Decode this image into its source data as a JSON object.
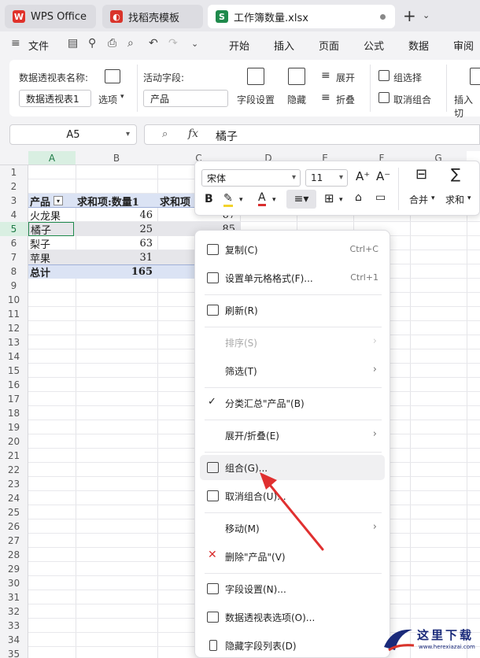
{
  "tabs": [
    {
      "label": "WPS Office",
      "icon_color": "#e0322b"
    },
    {
      "label": "找稻壳模板",
      "icon_color": "#d9342b"
    },
    {
      "label": "工作簿数量.xlsx",
      "icon_color": "#1f8a4c",
      "icon_letter": "S"
    }
  ],
  "menubar": {
    "file": "文件",
    "items": [
      "开始",
      "插入",
      "页面",
      "公式",
      "数据",
      "审阅"
    ]
  },
  "ribbon": {
    "pivot_name_label": "数据透视表名称:",
    "pivot_name_value": "数据透视表1",
    "options_label": "选项",
    "active_field_label": "活动字段:",
    "active_field_value": "产品",
    "field_settings": "字段设置",
    "hide": "隐藏",
    "expand": "展开",
    "collapse": "折叠",
    "group_selection": "组选择",
    "ungroup": "取消组合",
    "insert_slicer": "插入切"
  },
  "formula_bar": {
    "cell_ref": "A5",
    "fx": "fx",
    "value": "橘子"
  },
  "grid": {
    "columns": [
      "A",
      "B",
      "C",
      "D",
      "E",
      "F",
      "G"
    ],
    "rows": [
      "1",
      "2",
      "3",
      "4",
      "5",
      "6",
      "7",
      "8",
      "9",
      "10",
      "11",
      "12",
      "13",
      "14",
      "15",
      "16",
      "17",
      "18",
      "19",
      "20",
      "21",
      "22",
      "23",
      "24",
      "25",
      "26",
      "27",
      "28",
      "29",
      "30",
      "31",
      "32",
      "33",
      "34",
      "35"
    ],
    "header_row": {
      "a": "产品",
      "b": "求和项:数量1",
      "c": "求和项"
    },
    "data_rows": [
      {
        "a": "火龙果",
        "b": "46",
        "c": "67"
      },
      {
        "a": "橘子",
        "b": "25",
        "c": "85"
      },
      {
        "a": "梨子",
        "b": "63",
        "c": ""
      },
      {
        "a": "苹果",
        "b": "31",
        "c": ""
      }
    ],
    "total_row": {
      "a": "总计",
      "b": "165"
    }
  },
  "mini_toolbar": {
    "font": "宋体",
    "size": "11",
    "merge": "合并",
    "sum": "求和",
    "bold": "B"
  },
  "context_menu": [
    {
      "label": "复制(C)",
      "shortcut": "Ctrl+C"
    },
    {
      "label": "设置单元格格式(F)...",
      "shortcut": "Ctrl+1"
    },
    {
      "label": "刷新(R)"
    },
    {
      "label": "排序(S)",
      "disabled": true
    },
    {
      "label": "筛选(T)"
    },
    {
      "label": "分类汇总\"产品\"(B)"
    },
    {
      "label": "展开/折叠(E)"
    },
    {
      "label": "组合(G)..."
    },
    {
      "label": "取消组合(U)..."
    },
    {
      "label": "移动(M)"
    },
    {
      "label": "删除\"产品\"(V)"
    },
    {
      "label": "字段设置(N)..."
    },
    {
      "label": "数据透视表选项(O)..."
    },
    {
      "label": "隐藏字段列表(D)"
    }
  ],
  "watermark": {
    "title": "这里下载",
    "url": "www.herexiazai.com"
  },
  "colors": {
    "accent": "#1f8a4c",
    "pivot_header": "#dbe3f4",
    "arrow": "#e03030"
  }
}
